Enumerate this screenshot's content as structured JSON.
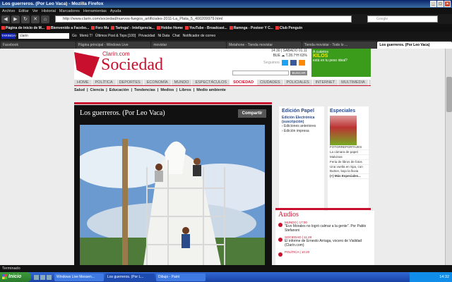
{
  "window": {
    "title": "Los guerreros. (Por Leo Vaca) - Mozilla Firefox"
  },
  "menu": [
    "Archivo",
    "Editar",
    "Ver",
    "Historial",
    "Marcadores",
    "Herramientas",
    "Ayuda"
  ],
  "toolbar": {
    "url": "http://www.clarin.com/sociedad/nuevos-fuegos_artificiales-2011-La_Plata_5_400209979.html",
    "search_placeholder": "Google"
  },
  "bookmarks": [
    "Página de inicio de M...",
    "Bienvenido a Facebo...",
    "Forz Mu",
    "Taringa! - Inteligencia...",
    "Hobbo Home",
    "YouTube - Broadcast...",
    "Ramnga - Posteer Y C...",
    "Club Penguin"
  ],
  "addon_bar": {
    "brand": "TARINGA!",
    "search_value": "clarin",
    "items": [
      "Go",
      "Menú T!",
      "Últimos Post & Tops [100]",
      "Privacidad",
      "Ni Data",
      "Chat",
      "Notificador de correo"
    ]
  },
  "tabs": [
    "Facebook",
    "Página principal - Windows Live",
    "movistar",
    "Metahone - Tienda movistar",
    "Tienda movistar - Todo lo ...",
    "Los guerreros. (Por Leo Vaca)"
  ],
  "active_tab": 5,
  "header": {
    "clarin": "Clarín.com",
    "section": "Sociedad",
    "info_lines": [
      "14:30 | SÁBADO 01.11",
      "BUE ☁ T.28.7ºH 63%"
    ],
    "seguinos": "Seguinos",
    "search_button": "BUSCAR",
    "ad_line1": "A cuántos",
    "ad_highlight": "KILOS",
    "ad_line2": "está en tu peso ideal?"
  },
  "nav": [
    "HOME",
    "POLÍTICA",
    "DEPORTES",
    "ECONOMÍA",
    "MUNDO",
    "ESPECTÁCULOS",
    "SOCIEDAD",
    "CIUDADES",
    "POLICIALES",
    "INTERNET",
    "MULTIMEDIA"
  ],
  "nav_active": 6,
  "subnav": [
    "Salud",
    "Ciencia",
    "Educación",
    "Tendencias",
    "Medios",
    "Libros",
    "Medio ambiente"
  ],
  "main": {
    "title": "Los guerreros. (Por Leo Vaca)",
    "share": "Compartir"
  },
  "edicion": {
    "title": "Edición Papel",
    "link": "Edición Electrónica (suscripción)",
    "items": [
      "› Ediciones anteriores",
      "› Edición impresa"
    ]
  },
  "especiales": {
    "title": "Especiales",
    "items": [
      "FOTORREPORTAJES",
      "La cámara de papel",
      "Malvinas",
      "Feria de libros de fotos",
      "Una vuelta en Spa, con Button, bajo la lluvia",
      "(+) Más Especiales..."
    ]
  },
  "audios": {
    "title": "Audios",
    "items": [
      {
        "cat": "MUNDO | 17:00",
        "text": "\"Evo Morales no logró calmar a la gente\". Por Pablo Stefanoni"
      },
      {
        "cat": "SOCIEDAD | 11:48",
        "text": "El informe de Ernesto Arriaga, vocero de Vialidad (Clarín.com)"
      },
      {
        "cat": "POLÍTICA | 10:20",
        "text": ""
      }
    ]
  },
  "status": "Terminado",
  "taskbar": {
    "start": "Inicio",
    "tasks": [
      "Windows Live Messen...",
      "Los guerreros. (Por L...",
      "Dibujo - Paint"
    ],
    "active_task": 1,
    "clock": "14:32"
  }
}
